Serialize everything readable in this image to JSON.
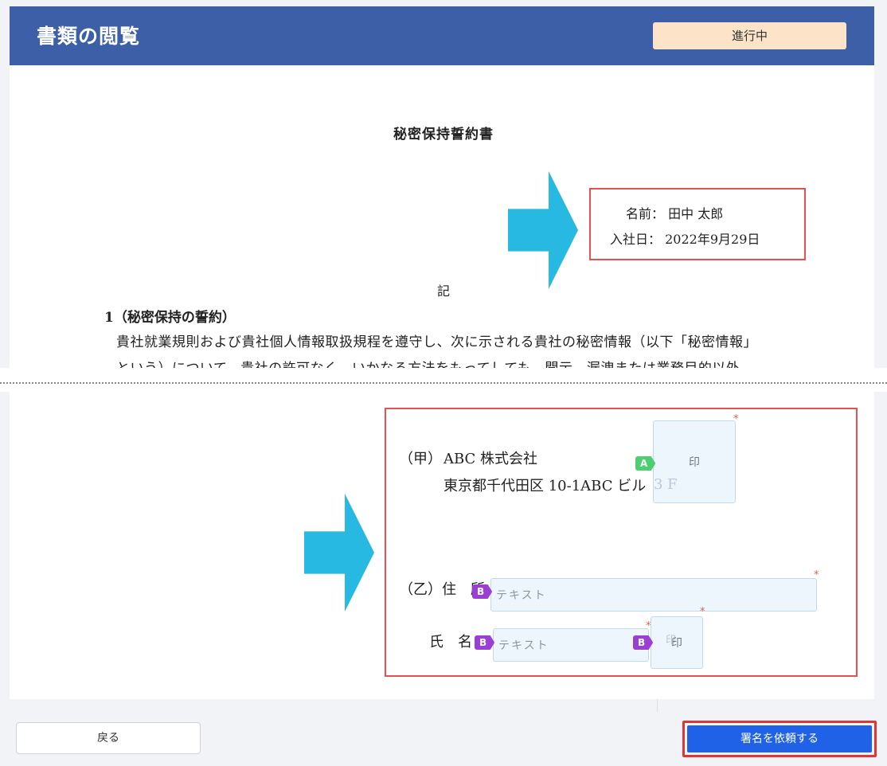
{
  "header": {
    "title": "書類の閲覧",
    "status": "進行中"
  },
  "document": {
    "title": "秘密保持誓約書",
    "info": {
      "name_label": "名前：",
      "name_value": "田中 太郎",
      "join_label": "入社日：",
      "join_value": "2022年9月29日"
    },
    "ki": "記",
    "section_heading": "1（秘密保持の誓約）",
    "body_line_1": "貴社就業規則および貴社個人情報取扱規程を遵守し、次に示される貴社の秘密情報（以下「秘密情報」",
    "body_line_2": "という）について、貴社の許可なく、いかなる方法をもってしても、開示、漏洩または業務目的以外"
  },
  "signature": {
    "party_a_label": "（甲）",
    "party_a_company": "ABC 株式会社",
    "party_a_address": "東京都千代田区 10-1ABC ビル",
    "party_a_floor": "3 F",
    "party_a_seal": "印",
    "party_a_tag": "A",
    "party_b_label": "（乙）住　所",
    "party_b_name_label": "氏　名",
    "address_placeholder": "テキスト",
    "name_placeholder": "テキスト",
    "party_b_seal": "印",
    "party_b_seal_ghost": "印",
    "party_b_tag": "B",
    "required_mark": "*"
  },
  "footer": {
    "back_label": "戻る",
    "request_label": "署名を依頼する"
  },
  "colors": {
    "header_bg": "#3c5fa8",
    "status_bg": "#fde4c8",
    "arrow": "#27b9e1",
    "highlight_border": "#e55050",
    "tag_a": "#4ccf6e",
    "tag_b": "#9b3fd4",
    "primary_button": "#1f62e8"
  }
}
